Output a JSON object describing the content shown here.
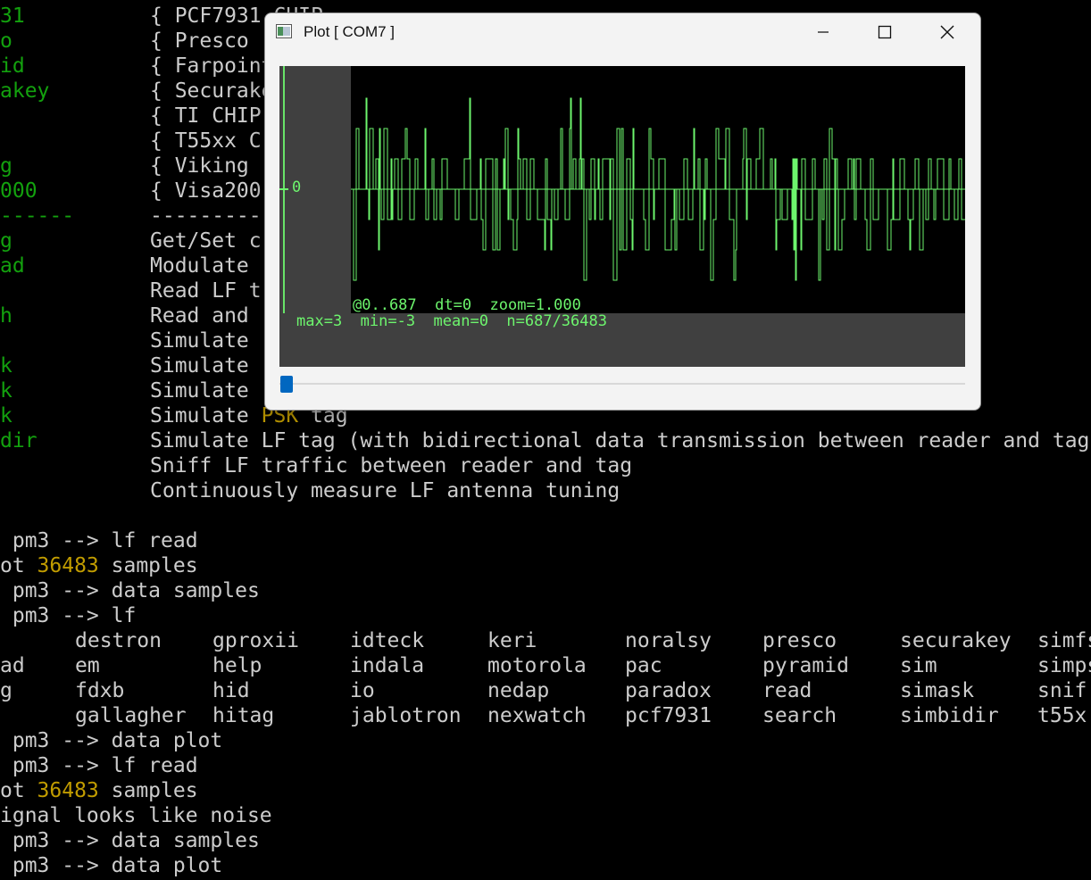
{
  "terminal": {
    "left_column": [
      {
        "row": 0,
        "text": "31"
      },
      {
        "row": 1,
        "text": "o"
      },
      {
        "row": 2,
        "text": "id"
      },
      {
        "row": 3,
        "text": "akey"
      },
      {
        "row": 6,
        "text": "g"
      },
      {
        "row": 7,
        "text": "000"
      },
      {
        "row": 9,
        "text": "g"
      },
      {
        "row": 10,
        "text": "ad"
      },
      {
        "row": 12,
        "text": "h"
      },
      {
        "row": 14,
        "text": "k"
      },
      {
        "row": 15,
        "text": "k"
      },
      {
        "row": 16,
        "text": "k"
      },
      {
        "row": 17,
        "text": "dir"
      }
    ],
    "left_separator": "------",
    "desc_column": [
      {
        "row": 0,
        "text": "{ PCF7931 CHIP"
      },
      {
        "row": 1,
        "text": "{ Presco"
      },
      {
        "row": 2,
        "text": "{ Farpoint"
      },
      {
        "row": 3,
        "text": "{ Securake"
      },
      {
        "row": 4,
        "text": "{ TI CHIP"
      },
      {
        "row": 5,
        "text": "{ T55xx C"
      },
      {
        "row": 6,
        "text": "{ Viking"
      },
      {
        "row": 7,
        "text": "{ Visa200"
      },
      {
        "row": 8,
        "text": "-----------"
      },
      {
        "row": 9,
        "text": "Get/Set c"
      },
      {
        "row": 10,
        "text": "Modulate"
      },
      {
        "row": 11,
        "text": "Read LF t"
      },
      {
        "row": 12,
        "text": "Read and"
      },
      {
        "row": 13,
        "text": "Simulate"
      },
      {
        "row": 14,
        "text": "Simulate"
      },
      {
        "row": 15,
        "text": "Simulate"
      }
    ],
    "psk_line": {
      "prefix": "Simulate ",
      "highlight": "PSK",
      "suffix": " tag"
    },
    "full_lines": [
      {
        "row": 17,
        "text": "Simulate LF tag (with bidirectional data transmission between reader and tag"
      },
      {
        "row": 18,
        "text": "Sniff LF traffic between reader and tag"
      },
      {
        "row": 19,
        "text": "Continuously measure LF antenna tuning"
      }
    ],
    "session": {
      "line1": " pm3 --> lf read",
      "line2_prefix": "ot ",
      "line2_number": "36483",
      "line2_suffix": " samples",
      "line3": " pm3 --> data samples",
      "line4": " pm3 --> lf",
      "line9": " pm3 --> data plot",
      "line10": " pm3 --> lf read",
      "line11_prefix": "ot ",
      "line11_number": "36483",
      "line11_suffix": " samples",
      "line12": "ignal looks like noise",
      "line13": " pm3 --> data samples",
      "line14": " pm3 --> data plot"
    },
    "completion_rows": [
      {
        "lead": "",
        "items": [
          "destron",
          "gproxii",
          "idteck",
          "keri",
          "noralsy",
          "presco",
          "securakey",
          "simfs"
        ]
      },
      {
        "lead": "ad",
        "items": [
          "em",
          "help",
          "indala",
          "motorola",
          "pac",
          "pyramid",
          "sim",
          "simps"
        ]
      },
      {
        "lead": "g",
        "items": [
          "fdxb",
          "hid",
          "io",
          "nedap",
          "paradox",
          "read",
          "simask",
          "snif"
        ]
      },
      {
        "lead": "",
        "items": [
          "gallagher",
          "hitag",
          "jablotron",
          "nexwatch",
          "pcf7931",
          "search",
          "simbidir",
          "t55x"
        ]
      }
    ]
  },
  "plot_window": {
    "title": "Plot [ COM7 ]",
    "zero_label": "0",
    "status_line": "@0..687  dt=0  zoom=1.000",
    "stats_line": "max=3  min=-3  mean=0  n=687/36483",
    "icons": {
      "app": "plot-app-icon",
      "minimize": "minimize-icon",
      "maximize": "maximize-icon",
      "close": "close-icon"
    }
  },
  "colors": {
    "terminal_green": "#13a10e",
    "terminal_yellow": "#c19c00",
    "plot_trace": "#6df56d",
    "scroll_thumb": "#0067c0"
  }
}
